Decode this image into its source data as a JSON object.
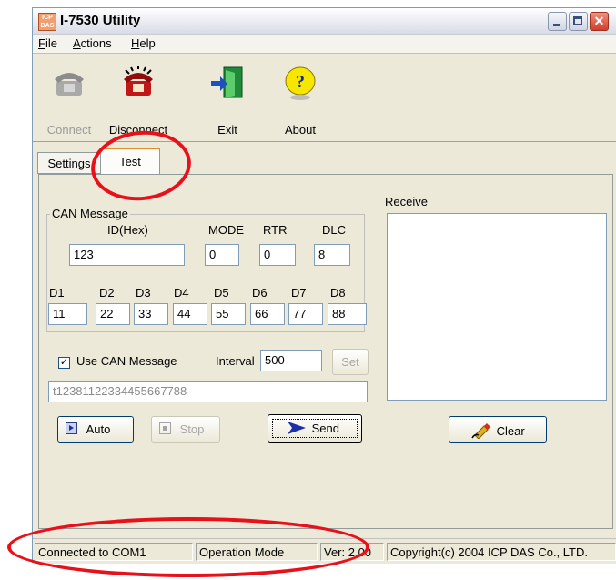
{
  "window": {
    "title": "I-7530 Utility",
    "icon_text": "ICP DAS",
    "controls": [
      "minimize-icon",
      "maximize-icon",
      "close-icon"
    ]
  },
  "menu": [
    {
      "label": "File",
      "accel": "F"
    },
    {
      "label": "Actions",
      "accel": "A"
    },
    {
      "label": "Help",
      "accel": "H"
    }
  ],
  "toolbar": {
    "connect": "Connect",
    "disconnect": "Disconnect",
    "exit": "Exit",
    "about": "About"
  },
  "tabs": {
    "settings": "Settings",
    "test": "Test",
    "active": "Test"
  },
  "can_message": {
    "group_label": "CAN Message",
    "headers": {
      "id": "ID(Hex)",
      "mode": "MODE",
      "rtr": "RTR",
      "dlc": "DLC"
    },
    "values": {
      "id": "123",
      "mode": "0",
      "rtr": "0",
      "dlc": "8"
    },
    "data_labels": [
      "D1",
      "D2",
      "D3",
      "D4",
      "D5",
      "D6",
      "D7",
      "D8"
    ],
    "data_values": [
      "11",
      "22",
      "33",
      "44",
      "55",
      "66",
      "77",
      "88"
    ]
  },
  "options": {
    "use_can_label": "Use CAN Message",
    "use_can_checked": true,
    "interval_label": "Interval",
    "interval_value": "500",
    "set_label": "Set",
    "command_string": "t12381122334455667788"
  },
  "buttons": {
    "auto": "Auto",
    "stop": "Stop",
    "send": "Send",
    "clear": "Clear"
  },
  "receive": {
    "label": "Receive",
    "content": ""
  },
  "status": {
    "connection": "Connected to COM1",
    "mode": "Operation Mode",
    "version": "Ver: 2.00",
    "copyright": "Copyright(c) 2004 ICP DAS Co., LTD."
  },
  "colors": {
    "annotation": "#e8101a",
    "send_arrow": "#1b2fa8",
    "titlebar": "#e8eaf0"
  }
}
